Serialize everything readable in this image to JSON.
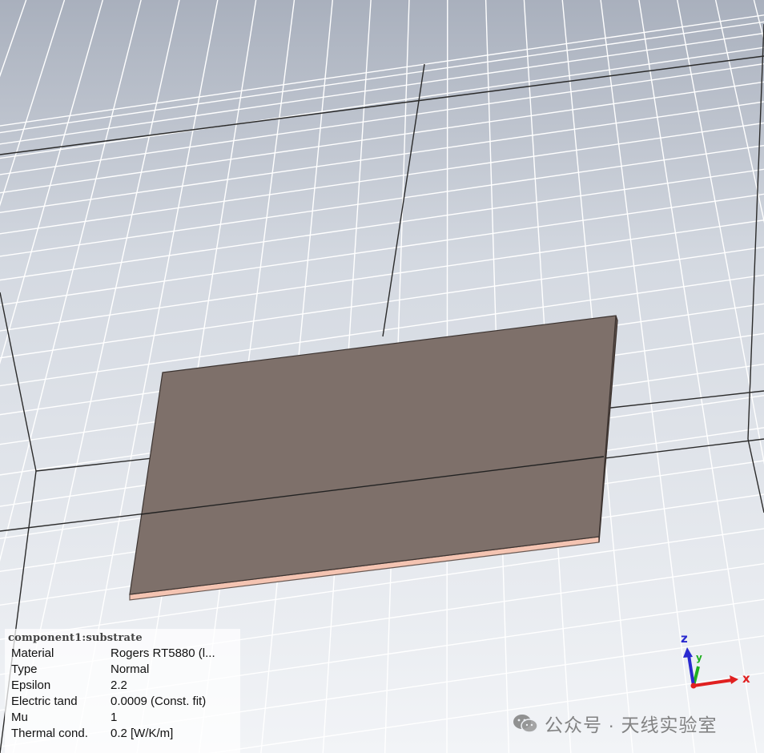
{
  "viewport": {
    "background_top": "#a9b0bd",
    "background_bottom": "#f2f4f7",
    "grid_color": "#ffffff",
    "grid_major_color": "#2b2b2b",
    "substrate_top_color": "#7e706a",
    "substrate_edge_color": "#f4c4b2"
  },
  "info_panel": {
    "title": "component1:substrate",
    "rows": [
      {
        "label": "Material",
        "value": "Rogers RT5880 (l..."
      },
      {
        "label": "Type",
        "value": "Normal"
      },
      {
        "label": "Epsilon",
        "value": "2.2"
      },
      {
        "label": "Electric tand",
        "value": "0.0009 (Const. fit)"
      },
      {
        "label": "Mu",
        "value": "1"
      },
      {
        "label": "Thermal cond.",
        "value": "0.2 [W/K/m]"
      }
    ]
  },
  "axes": {
    "x_label": "x",
    "y_label": "y",
    "z_label": "z",
    "x_color": "#e02020",
    "y_color": "#20b020",
    "z_color": "#2a2ad0"
  },
  "watermark": {
    "icon": "wechat-icon",
    "text": "公众号 · 天线实验室"
  }
}
